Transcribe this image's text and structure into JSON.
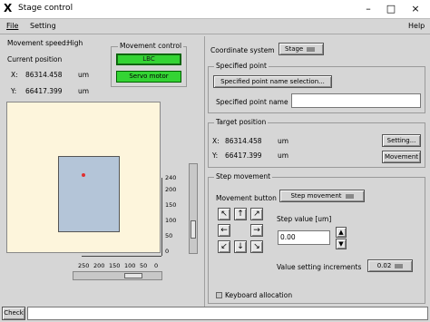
{
  "window": {
    "title": "Stage control",
    "minimize": "–",
    "maximize": "□",
    "close": "×"
  },
  "menu": {
    "file": "File",
    "setting": "Setting",
    "help": "Help"
  },
  "left": {
    "movement_speed_label": "Movement speed:",
    "movement_speed_value": "High",
    "current_position_label": "Current position",
    "x_label": "X:",
    "x_value": "86314.458",
    "x_unit": "um",
    "y_label": "Y:",
    "y_value": "66417.399",
    "y_unit": "um"
  },
  "movement_control": {
    "title": "Movement control",
    "lbc": "LBC",
    "servo": "Servo motor"
  },
  "map": {
    "y_ticks": [
      "240",
      "200",
      "150",
      "100",
      "50",
      "0"
    ],
    "x_ticks": [
      "250",
      "200",
      "150",
      "100",
      "50",
      "0"
    ],
    "bg_color": "#fdf5dc",
    "region_color": "#b4c5d8",
    "marker_color": "#e03030"
  },
  "coordinate_system": {
    "label": "Coordinate system",
    "value": "Stage"
  },
  "specified_point": {
    "title": "Specified point",
    "select_button": "Specified point name selection...",
    "name_label": "Specified point name",
    "name_value": ""
  },
  "target_position": {
    "title": "Target position",
    "x_label": "X:",
    "x_value": "86314.458",
    "x_unit": "um",
    "y_label": "Y:",
    "y_value": "66417.399",
    "y_unit": "um",
    "setting_button": "Setting...",
    "movement_button": "Movement"
  },
  "step_movement": {
    "title": "Step movement",
    "movement_button_label": "Movement button",
    "movement_mode": "Step movement",
    "step_value_label": "Step value [um]",
    "step_value": "0.00",
    "increment_label": "Value setting increments",
    "increment_value": "0.02",
    "keyboard_label": "Keyboard allocation",
    "arrows": [
      "↖",
      "↑",
      "↗",
      "←",
      "→",
      "↙",
      "↓",
      "↘"
    ]
  },
  "bottom": {
    "check_button": "Check",
    "status_text": ""
  }
}
